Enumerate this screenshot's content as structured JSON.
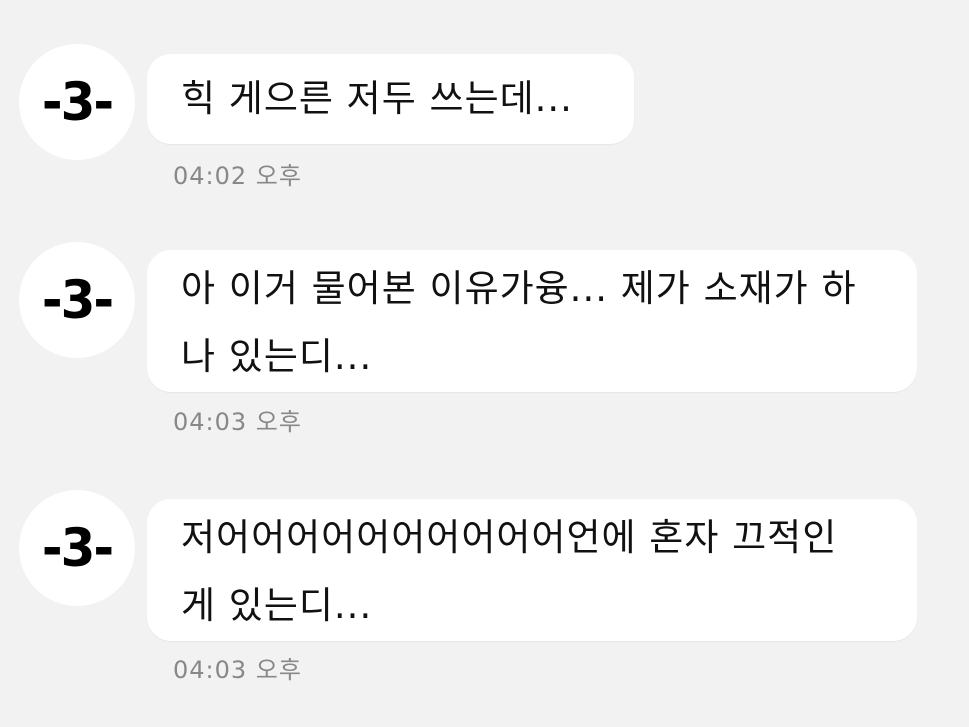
{
  "messages": [
    {
      "avatar": "-3-",
      "text": "힉 게으른 저두 쓰는데...",
      "time": "04:02 오후"
    },
    {
      "avatar": "-3-",
      "text": "아 이거 물어본 이유가융... 제가 소재가 하나 있는디...",
      "time": "04:03 오후"
    },
    {
      "avatar": "-3-",
      "text": "저어어어어어어어어어어언에 혼자 끄적인 게 있는디...",
      "time": "04:03 오후"
    }
  ]
}
